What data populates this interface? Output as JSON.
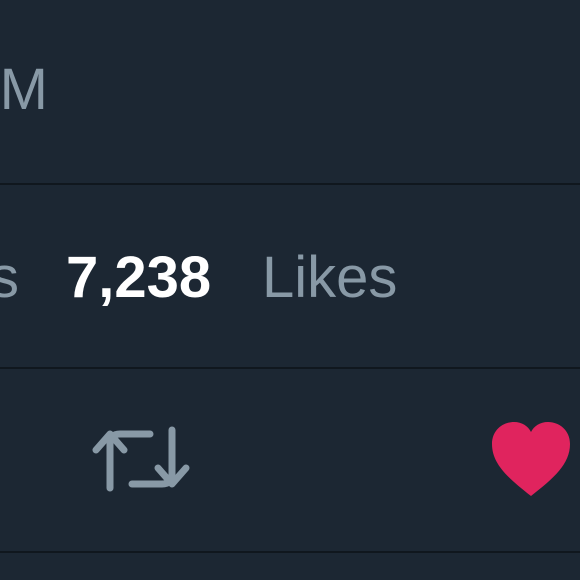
{
  "tweet": {
    "timestamp_fragment": "PM",
    "stats": {
      "prev_label_fragment": "s",
      "likes_count": "7,238",
      "likes_label": "Likes"
    },
    "actions": {
      "retweet_icon": "retweet-icon",
      "like_icon": "heart-icon",
      "like_active": true,
      "like_color": "#e0245e",
      "icon_color": "#8899a6"
    }
  },
  "colors": {
    "background": "#1c2733",
    "divider": "#10171e",
    "secondary_text": "#8899a6",
    "primary_text": "#ffffff"
  }
}
